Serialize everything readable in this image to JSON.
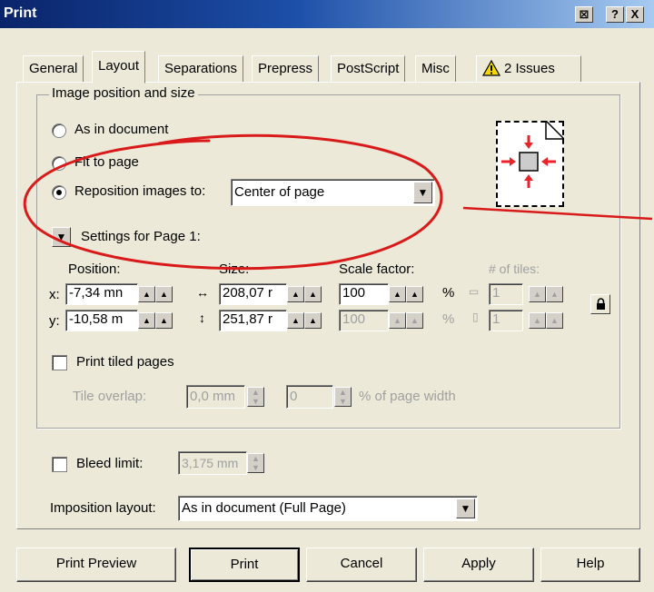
{
  "window": {
    "title": "Print",
    "buttons": {
      "context": "⊠",
      "help": "?",
      "close": "X"
    }
  },
  "tabs": [
    {
      "label": "General",
      "active": false
    },
    {
      "label": "Layout",
      "active": true
    },
    {
      "label": "Separations",
      "active": false
    },
    {
      "label": "Prepress",
      "active": false
    },
    {
      "label": "PostScript",
      "active": false
    },
    {
      "label": "Misc",
      "active": false
    },
    {
      "label": "2 Issues",
      "active": false,
      "icon": "warning-icon"
    }
  ],
  "image_position": {
    "group_label": "Image position and size",
    "radio_as_in_document": "As in document",
    "radio_fit_to_page": "Fit to page",
    "radio_reposition": "Reposition images to:",
    "selected": "Reposition images to:",
    "reposition_value": "Center of page",
    "settings_for_page": "Settings for Page 1:"
  },
  "fields": {
    "position_label": "Position:",
    "size_label": "Size:",
    "scale_label": "Scale factor:",
    "tiles_label": "# of tiles:",
    "x_label": "x:",
    "y_label": "y:",
    "x_value": "-7,34 mn",
    "y_value": "-10,58 m",
    "width_value": "208,07 r",
    "height_value": "251,87 r",
    "scale_x": "100",
    "scale_y": "100",
    "percent": "%",
    "tiles_x": "1",
    "tiles_y": "1"
  },
  "tiling": {
    "print_tiled_pages": "Print tiled pages",
    "tile_overlap_label": "Tile overlap:",
    "tile_overlap_value": "0,0 mm",
    "tile_percent_value": "0",
    "tile_percent_label": "% of page width"
  },
  "bleed": {
    "label": "Bleed limit:",
    "value": "3,175 mm"
  },
  "imposition": {
    "label": "Imposition layout:",
    "value": "As in document (Full Page)"
  },
  "buttons": {
    "print_preview": "Print Preview",
    "print": "Print",
    "cancel": "Cancel",
    "apply": "Apply",
    "help": "Help"
  },
  "colors": {
    "annotation": "#d91a1a",
    "arrow": "#e8242a",
    "warning": "#f5d800"
  }
}
